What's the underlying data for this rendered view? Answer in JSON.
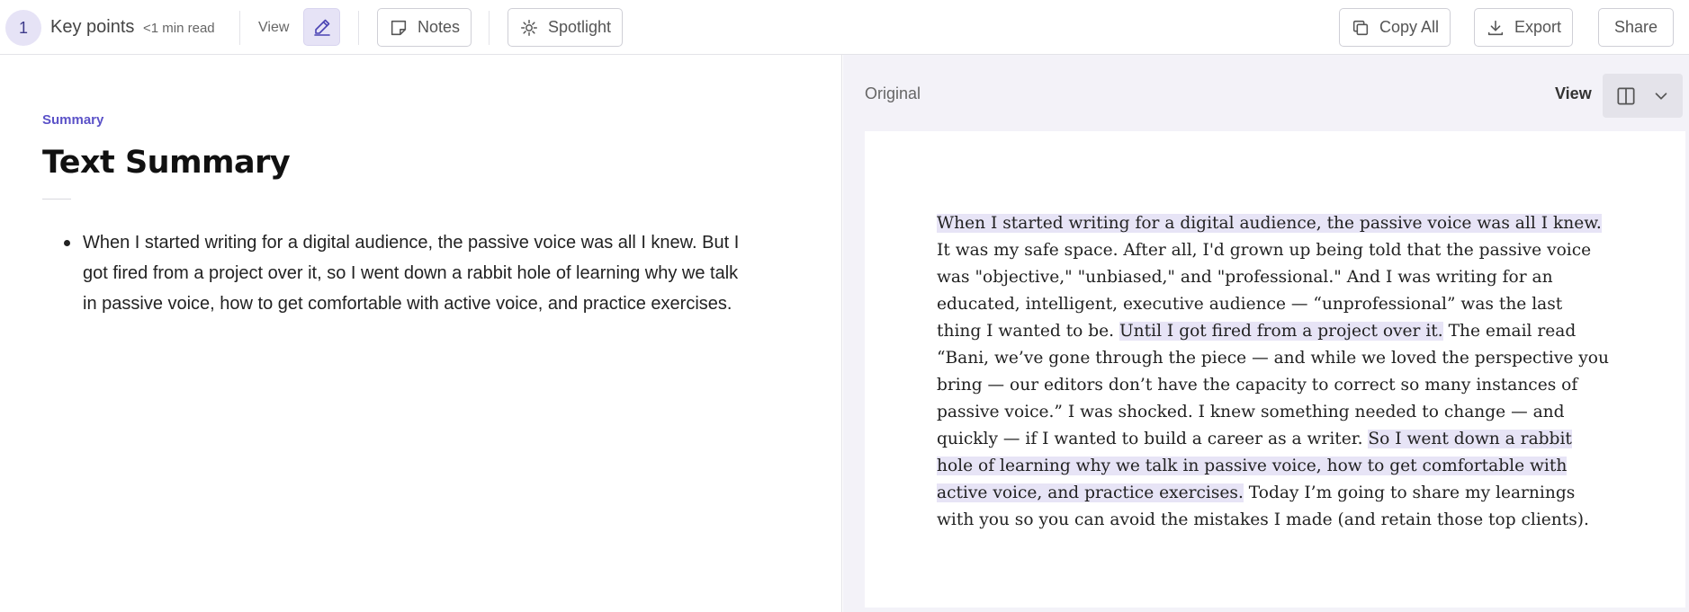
{
  "toolbar": {
    "badge_number": "1",
    "title": "Key points",
    "read_time": "<1 min read",
    "view_label": "View",
    "notes_label": "Notes",
    "spotlight_label": "Spotlight",
    "copy_all_label": "Copy All",
    "export_label": "Export",
    "share_label": "Share"
  },
  "summary": {
    "eyebrow": "Summary",
    "title": "Text Summary",
    "bullets": [
      "When I started writing for a digital audience, the passive voice was all I knew. But I got fired from a project over it, so I went down a rabbit hole of learning why we talk in passive voice, how to get comfortable with active voice, and practice exercises."
    ]
  },
  "original": {
    "label": "Original",
    "view_label": "View",
    "segments": [
      {
        "text": "When I started writing for a digital audience, the passive voice was all I knew.",
        "highlighted": true
      },
      {
        "text": " It was my safe space. After all, I'd grown up being told that the passive voice was \"objective,\" \"unbiased,\" and \"professional.\" And I was writing for an educated, intelligent, executive audience — “unprofessional” was the last thing I wanted to be. ",
        "highlighted": false
      },
      {
        "text": "Until I got fired from a project over it.",
        "highlighted": true
      },
      {
        "text": " The email read “Bani, we’ve gone through the piece — and while we loved the perspective you bring — our editors don’t have the capacity to correct so many instances of passive voice.” I was shocked. I knew something needed to change — and quickly — if I wanted to build a career as a writer. ",
        "highlighted": false
      },
      {
        "text": "So I went down a rabbit hole of learning why we talk in passive voice, how to get comfortable with active voice, and practice exercises.",
        "highlighted": true
      },
      {
        "text": " Today I’m going to share my learnings with you so you can avoid the mistakes I made (and retain those top clients).",
        "highlighted": false
      }
    ]
  },
  "colors": {
    "accent": "#5b52c8",
    "highlight": "#e7e4f6",
    "panel_bg": "#f3f2f8"
  },
  "icons": {
    "pen": "pen-icon",
    "notes": "sticky-note-icon",
    "spotlight": "spotlight-icon",
    "copy": "copy-icon",
    "export": "download-icon",
    "layout": "split-view-icon",
    "chevron": "chevron-down-icon"
  }
}
